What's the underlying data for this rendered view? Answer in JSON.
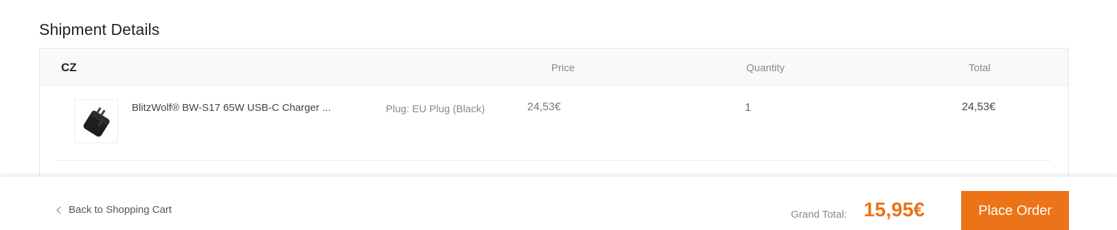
{
  "shipment": {
    "title": "Shipment Details",
    "country": "CZ",
    "columns": {
      "price": "Price",
      "quantity": "Quantity",
      "total": "Total"
    },
    "items": [
      {
        "name": "BlitzWolf® BW-S17 65W USB-C Charger ...",
        "variant": "Plug: EU Plug (Black)",
        "price": "24,53€",
        "quantity": "1",
        "total": "24,53€",
        "image_icon": "usb-charger-product-image"
      }
    ]
  },
  "footer": {
    "back_label": "Back to Shopping Cart",
    "back_icon": "chevron-left-icon",
    "grand_total_label": "Grand Total:",
    "grand_total_value": "15,95€",
    "place_order_label": "Place Order"
  },
  "colors": {
    "accent": "#ec7318",
    "grand_total": "#ee7216",
    "header_bg": "#f9f9f9"
  }
}
